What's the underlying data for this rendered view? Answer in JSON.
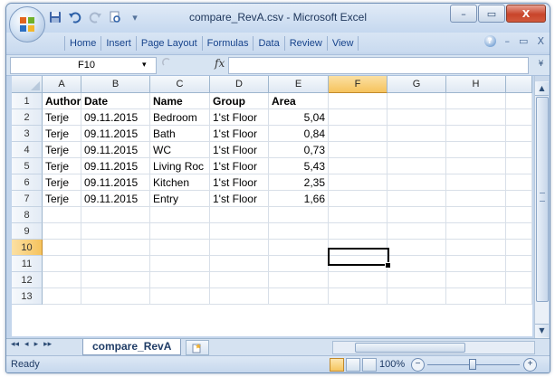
{
  "window": {
    "title": "compare_RevA.csv - Microsoft Excel",
    "controls": {
      "minimize": "–",
      "restore": "▭",
      "close": "X"
    }
  },
  "quick_access": {
    "save_icon": "save-icon",
    "undo_icon": "undo-icon",
    "redo_icon": "redo-icon",
    "preview_icon": "print-preview-icon",
    "dropdown": "▾"
  },
  "ribbon": {
    "tabs": [
      "Home",
      "Insert",
      "Page Layout",
      "Formulas",
      "Data",
      "Review",
      "View"
    ],
    "help": "?",
    "minimize": "–",
    "restore": "▭",
    "close": "X"
  },
  "formula_bar": {
    "name_box": "F10",
    "name_box_arrow": "▾",
    "fx": "fx",
    "value": "",
    "expand": "¥"
  },
  "grid": {
    "columns": [
      "A",
      "B",
      "C",
      "D",
      "E",
      "F",
      "G",
      "H"
    ],
    "selected_column": "F",
    "rows": [
      "1",
      "2",
      "3",
      "4",
      "5",
      "6",
      "7",
      "8",
      "9",
      "10",
      "11",
      "12",
      "13"
    ],
    "selected_row": "10",
    "active_cell": "F10",
    "header": [
      "Author",
      "Date",
      "Name",
      "Group",
      "Area"
    ],
    "data": [
      [
        "Terje",
        "09.11.2015",
        "Bedroom",
        "1'st Floor",
        "5,04"
      ],
      [
        "Terje",
        "09.11.2015",
        "Bath",
        "1'st Floor",
        "0,84"
      ],
      [
        "Terje",
        "09.11.2015",
        "WC",
        "1'st Floor",
        "0,73"
      ],
      [
        "Terje",
        "09.11.2015",
        "Living Roc",
        "1'st Floor",
        "5,43"
      ],
      [
        "Terje",
        "09.11.2015",
        "Kitchen",
        "1'st Floor",
        "2,35"
      ],
      [
        "Terje",
        "09.11.2015",
        "Entry",
        "1'st Floor",
        "1,66"
      ]
    ]
  },
  "sheets": {
    "nav": [
      "◂◂",
      "◂",
      "▸",
      "▸▸"
    ],
    "tabs": [
      "compare_RevA"
    ]
  },
  "status": {
    "text": "Ready",
    "zoom": "100%",
    "zoom_out": "−",
    "zoom_in": "+"
  }
}
